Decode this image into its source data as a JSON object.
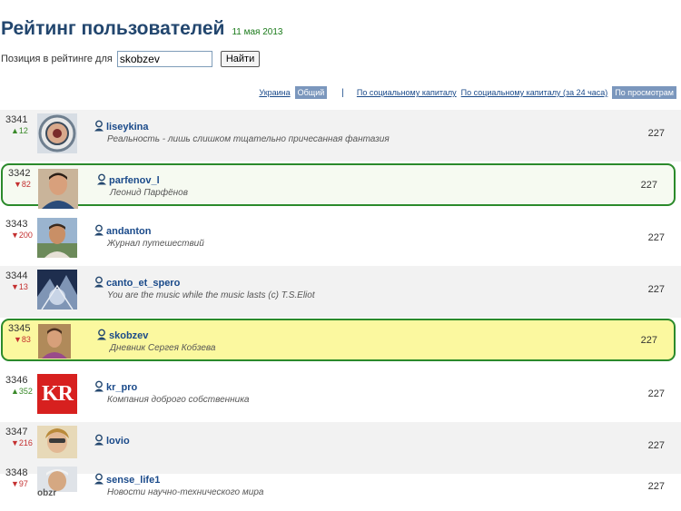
{
  "header": {
    "title": "Рейтинг пользователей",
    "date": "11 мая 2013"
  },
  "search": {
    "label": "Позиция в рейтинге для",
    "value": "skobzev",
    "button": "Найти"
  },
  "filters": {
    "ukraine": "Украина",
    "general": "Общий",
    "separator": "|",
    "social_capital": "По социальному капиталу",
    "social_capital_24h": "По социальному капиталу (за 24 часа)",
    "by_views": "По просмотрам"
  },
  "colors": {
    "highlight_border": "#2b8a2b",
    "self_row": "#fbf89f",
    "link": "#1a4a8a",
    "active_tab": "#7b97bd"
  },
  "rows": [
    {
      "rank": "3341",
      "delta": "▲12",
      "trend": "up",
      "name": "liseykina",
      "description": "Реальность - лишь слишком тщательно причесанная фантазия",
      "score": "227"
    },
    {
      "rank": "3342",
      "delta": "▼82",
      "trend": "down",
      "name": "parfenov_l",
      "description": "Леонид Парфёнов",
      "score": "227"
    },
    {
      "rank": "3343",
      "delta": "▼200",
      "trend": "down",
      "name": "andanton",
      "description": "Журнал путешествий",
      "score": "227"
    },
    {
      "rank": "3344",
      "delta": "▼13",
      "trend": "down",
      "name": "canto_et_spero",
      "description": "You are the music while the music lasts (c) T.S.Eliot",
      "score": "227"
    },
    {
      "rank": "3345",
      "delta": "▼83",
      "trend": "down",
      "name": "skobzev",
      "description": "Дневник Сергея Кобзева",
      "score": "227"
    },
    {
      "rank": "3346",
      "delta": "▲352",
      "trend": "up",
      "name": "kr_pro",
      "description": "Компания доброго собственника",
      "score": "227",
      "avatar_text": "KR"
    },
    {
      "rank": "3347",
      "delta": "▼216",
      "trend": "down",
      "name": "lovio",
      "description": "",
      "score": "227"
    },
    {
      "rank": "3348",
      "delta": "▼97",
      "trend": "down",
      "name": "sense_life1",
      "description": "Новости научно-технического мира",
      "score": "227",
      "avatar_text": "obzr"
    }
  ]
}
